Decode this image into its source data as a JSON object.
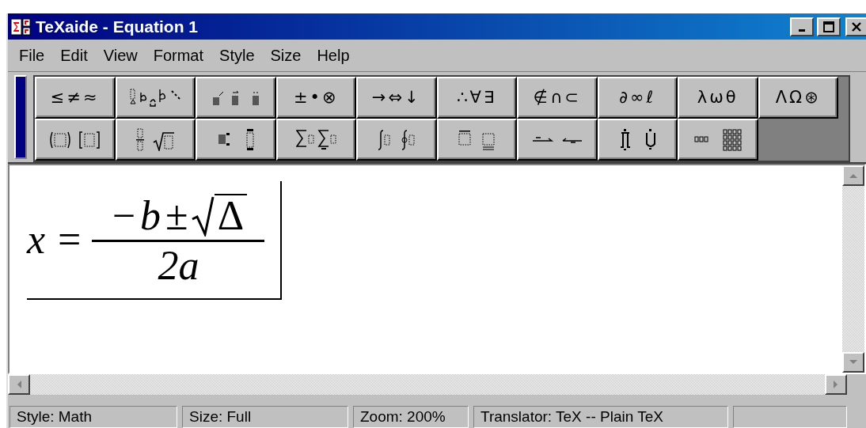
{
  "window": {
    "title": "TeXaide - Equation 1"
  },
  "menu": [
    "File",
    "Edit",
    "View",
    "Format",
    "Style",
    "Size",
    "Help"
  ],
  "palette_rows": [
    [
      {
        "kind": "symbols",
        "label": "≤≠≈"
      },
      {
        "kind": "template"
      },
      {
        "kind": "template"
      },
      {
        "kind": "symbols",
        "label": "±•⊗"
      },
      {
        "kind": "symbols",
        "label": "→⇔↓"
      },
      {
        "kind": "symbols",
        "label": "∴∀∃"
      },
      {
        "kind": "symbols",
        "label": "∉∩⊂"
      },
      {
        "kind": "symbols",
        "label": "∂∞ℓ"
      },
      {
        "kind": "symbols",
        "label": "λωθ"
      },
      {
        "kind": "symbols",
        "label": "ΛΩ⊛"
      }
    ],
    [
      {
        "kind": "template"
      },
      {
        "kind": "template"
      },
      {
        "kind": "template"
      },
      {
        "kind": "template"
      },
      {
        "kind": "template"
      },
      {
        "kind": "template"
      },
      {
        "kind": "template"
      },
      {
        "kind": "template"
      },
      {
        "kind": "template"
      }
    ]
  ],
  "equation": {
    "lhs": "x",
    "relation": "=",
    "numerator": [
      "−",
      "b",
      "±"
    ],
    "radicand": "Δ",
    "denominator": "2a"
  },
  "status_bar": [
    "Style: Math",
    "Size: Full",
    "Zoom: 200%",
    "Translator: TeX -- Plain TeX"
  ]
}
